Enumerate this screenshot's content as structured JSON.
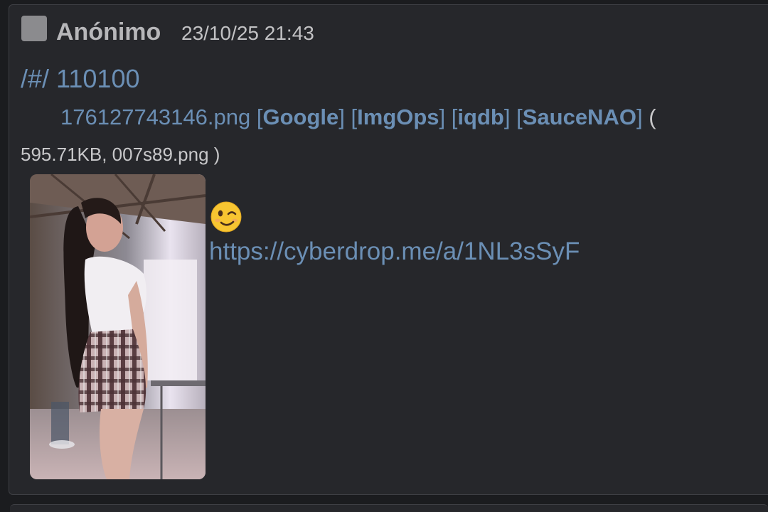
{
  "post": {
    "author": "Anónimo",
    "date": "23/10/25 21:43",
    "post_number": "/#/ 110100",
    "file": {
      "filename": "176127743146.png",
      "services": [
        "Google",
        "ImgOps",
        "iqdb",
        "SauceNAO"
      ],
      "open_paren": "(",
      "size_and_original": "595.71KB, 007s89.png )"
    },
    "emoji": "winking-face",
    "link": "https://cyberdrop.me/a/1NL3sSyF"
  },
  "colors": {
    "background": "#1b1c1f",
    "post_background": "#26272b",
    "link": "#6b8fb5",
    "author": "#b7b7ba",
    "text": "#c8c8ca"
  }
}
